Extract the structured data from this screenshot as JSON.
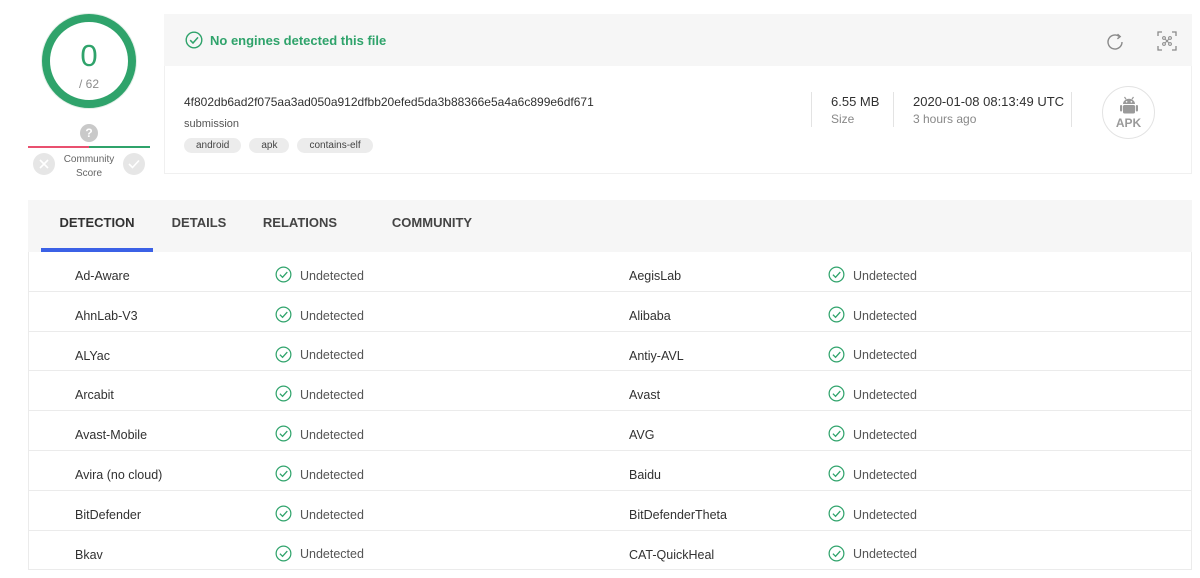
{
  "score": {
    "detections": "0",
    "total": "/ 62"
  },
  "community": {
    "unknown_symbol": "?",
    "label": "Community Score"
  },
  "summary": {
    "text": "No engines detected this file"
  },
  "file": {
    "hash": "4f802db6ad2f075aa3ad050a912dfbb20efed5da3b88366e5a4a6c899e6df671",
    "name": "submission",
    "tags": [
      "android",
      "apk",
      "contains-elf"
    ],
    "size_value": "6.55 MB",
    "size_label": "Size",
    "date_value": "2020-01-08 08:13:49 UTC",
    "date_relative": "3 hours ago",
    "type_label": "APK"
  },
  "tabs": [
    {
      "label": "DETECTION",
      "active": true
    },
    {
      "label": "DETAILS",
      "active": false
    },
    {
      "label": "RELATIONS",
      "active": false
    },
    {
      "label": "COMMUNITY",
      "active": false
    }
  ],
  "detections": [
    {
      "left_engine": "Ad-Aware",
      "left_result": "Undetected",
      "right_engine": "AegisLab",
      "right_result": "Undetected"
    },
    {
      "left_engine": "AhnLab-V3",
      "left_result": "Undetected",
      "right_engine": "Alibaba",
      "right_result": "Undetected"
    },
    {
      "left_engine": "ALYac",
      "left_result": "Undetected",
      "right_engine": "Antiy-AVL",
      "right_result": "Undetected"
    },
    {
      "left_engine": "Arcabit",
      "left_result": "Undetected",
      "right_engine": "Avast",
      "right_result": "Undetected"
    },
    {
      "left_engine": "Avast-Mobile",
      "left_result": "Undetected",
      "right_engine": "AVG",
      "right_result": "Undetected"
    },
    {
      "left_engine": "Avira (no cloud)",
      "left_result": "Undetected",
      "right_engine": "Baidu",
      "right_result": "Undetected"
    },
    {
      "left_engine": "BitDefender",
      "left_result": "Undetected",
      "right_engine": "BitDefenderTheta",
      "right_result": "Undetected"
    },
    {
      "left_engine": "Bkav",
      "left_result": "Undetected",
      "right_engine": "CAT-QuickHeal",
      "right_result": "Undetected"
    }
  ],
  "colors": {
    "clean": "#2fa36b",
    "malicious": "#e9506f",
    "accent": "#3b61e6"
  },
  "icons": {
    "summary": "check-circle-icon",
    "reanalyze": "refresh-icon",
    "similar": "focus-frame-icon",
    "filetype": "android-icon",
    "vote_down": "x-icon",
    "vote_up": "check-icon",
    "result": "check-circle-icon"
  }
}
